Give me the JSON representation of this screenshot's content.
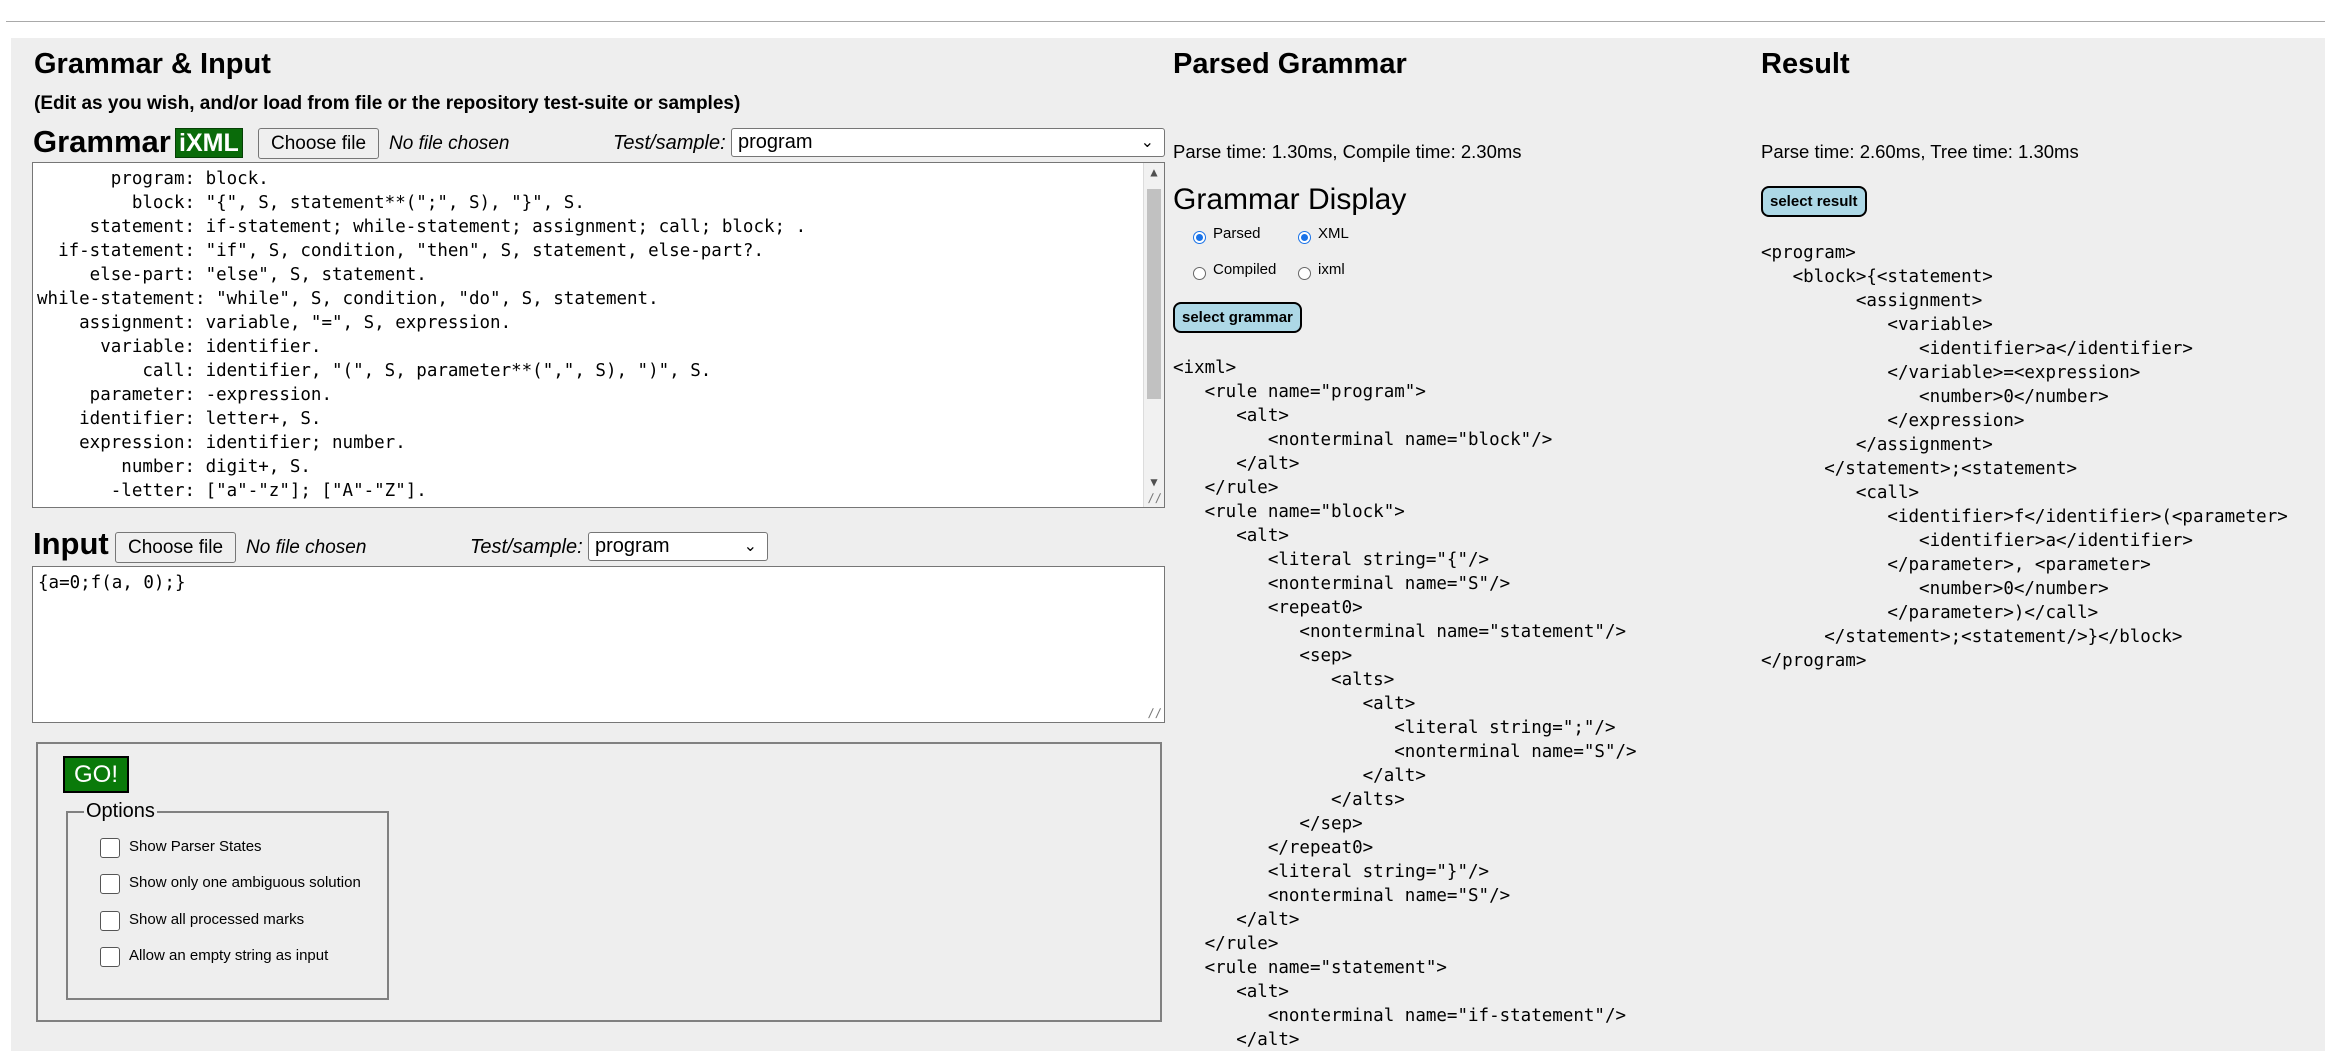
{
  "grammar_input": {
    "heading": "Grammar & Input",
    "subheading": "(Edit as you wish, and/or load from file or the repository test-suite or samples)",
    "grammar_label": "Grammar",
    "ixml_badge": "iXML",
    "choose_file": "Choose file",
    "no_file": "No file chosen",
    "testsample_label": "Test/sample:",
    "grammar_sample": "program",
    "grammar_lines": [
      "       program: block.",
      "         block: \"{\", S, statement**(\";\", S), \"}\", S.",
      "     statement: if-statement; while-statement; assignment; call; block; .",
      "  if-statement: \"if\", S, condition, \"then\", S, statement, else-part?.",
      "     else-part: \"else\", S, statement.",
      "while-statement: \"while\", S, condition, \"do\", S, statement.",
      "    assignment: variable, \"=\", S, expression.",
      "      variable: identifier.",
      "          call: identifier, \"(\", S, parameter**(\",\", S), \")\", S.",
      "     parameter: -expression.",
      "    identifier: letter+, S.",
      "    expression: identifier; number.",
      "        number: digit+, S.",
      "       -letter: [\"a\"-\"z\"]; [\"A\"-\"Z\"]."
    ],
    "input_label": "Input",
    "input_sample": "program",
    "input_text": "{a=0;f(a, 0);}",
    "go_label": "GO!",
    "options_legend": "Options",
    "options": [
      "Show Parser States",
      "Show only one ambiguous solution",
      "Show all processed marks",
      "Allow an empty string as input"
    ]
  },
  "parsed_grammar": {
    "heading": "Parsed Grammar",
    "stats": "Parse time: 1.30ms, Compile time: 2.30ms",
    "display_heading": "Grammar Display",
    "radio_parsed": "Parsed",
    "radio_xml": "XML",
    "radio_compiled": "Compiled",
    "radio_ixml": "ixml",
    "select_button": "select grammar",
    "xml_lines": [
      "<ixml>",
      "   <rule name=\"program\">",
      "      <alt>",
      "         <nonterminal name=\"block\"/>",
      "      </alt>",
      "   </rule>",
      "   <rule name=\"block\">",
      "      <alt>",
      "         <literal string=\"{\"/>",
      "         <nonterminal name=\"S\"/>",
      "         <repeat0>",
      "            <nonterminal name=\"statement\"/>",
      "            <sep>",
      "               <alts>",
      "                  <alt>",
      "                     <literal string=\";\"/>",
      "                     <nonterminal name=\"S\"/>",
      "                  </alt>",
      "               </alts>",
      "            </sep>",
      "         </repeat0>",
      "         <literal string=\"}\"/>",
      "         <nonterminal name=\"S\"/>",
      "      </alt>",
      "   </rule>",
      "   <rule name=\"statement\">",
      "      <alt>",
      "         <nonterminal name=\"if-statement\"/>",
      "      </alt>"
    ]
  },
  "result": {
    "heading": "Result",
    "stats": "Parse time: 2.60ms, Tree time: 1.30ms",
    "select_button": "select result",
    "xml_lines": [
      "<program>",
      "   <block>{<statement>",
      "         <assignment>",
      "            <variable>",
      "               <identifier>a</identifier>",
      "            </variable>=<expression>",
      "               <number>0</number>",
      "            </expression>",
      "         </assignment>",
      "      </statement>;<statement>",
      "         <call>",
      "            <identifier>f</identifier>(<parameter>",
      "               <identifier>a</identifier>",
      "            </parameter>, <parameter>",
      "               <number>0</number>",
      "            </parameter>)</call>",
      "      </statement>;<statement/>}</block>",
      "</program>"
    ]
  }
}
